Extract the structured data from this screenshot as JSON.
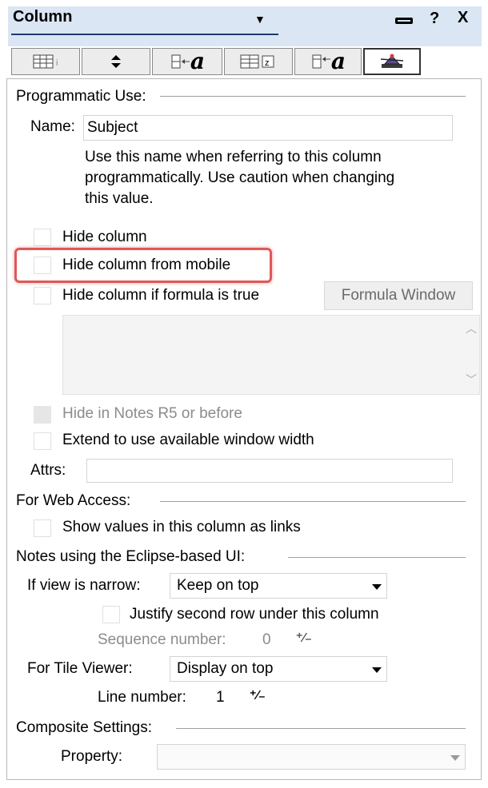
{
  "header": {
    "title": "Column",
    "help_glyph": "?",
    "close_glyph": "X"
  },
  "tabs": [
    {
      "icon": "table-info-icon"
    },
    {
      "icon": "sort-icon",
      "glyph": "↕"
    },
    {
      "icon": "font-a-icon",
      "glyph": "a"
    },
    {
      "icon": "number-format-icon"
    },
    {
      "icon": "title-font-a-icon",
      "glyph": "a"
    },
    {
      "icon": "advanced-hat-icon",
      "active": true
    }
  ],
  "programmatic": {
    "legend": "Programmatic Use:",
    "name_label": "Name:",
    "name_value": "Subject",
    "help_line1": "Use this name when referring to this column",
    "help_line2": "programmatically.  Use caution when changing",
    "help_line3": "this value."
  },
  "options": {
    "hide_column": "Hide column",
    "hide_mobile": "Hide column from mobile",
    "hide_formula": "Hide column if formula is true",
    "formula_button": "Formula Window",
    "hide_r5": "Hide in Notes R5 or before",
    "extend": "Extend to use available window width",
    "attrs_label": "Attrs:",
    "attrs_value": ""
  },
  "web": {
    "legend": "For Web Access:",
    "show_links": "Show values in this column as links"
  },
  "eclipse": {
    "legend": "Notes using the  Eclipse-based UI:",
    "narrow_label": "If view is narrow:",
    "narrow_value": "Keep on top",
    "justify": "Justify second row under this column",
    "sequence_label": "Sequence number:",
    "sequence_value": "0",
    "tile_label": "For Tile Viewer:",
    "tile_value": "Display on top",
    "line_label": "Line number:",
    "line_value": "1"
  },
  "composite": {
    "legend": "Composite Settings:",
    "property_label": "Property:",
    "property_value": ""
  },
  "colors": {
    "titlebar": "#dbe6f4",
    "highlight": "#e05858"
  }
}
